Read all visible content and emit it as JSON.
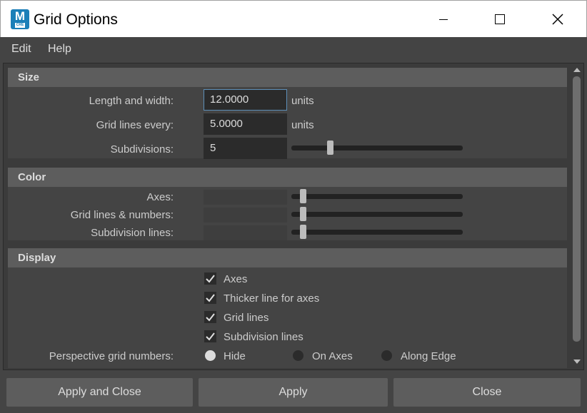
{
  "window": {
    "title": "Grid Options",
    "app_icon_letter": "M",
    "app_icon_badge": "CRE",
    "controls": {
      "minimize": "minimize-icon",
      "maximize": "maximize-icon",
      "close": "close-icon"
    }
  },
  "menu": [
    {
      "label": "Edit"
    },
    {
      "label": "Help"
    }
  ],
  "sections": {
    "size": {
      "title": "Size",
      "length_width": {
        "label": "Length and width:",
        "value": "12.0000",
        "unit": "units"
      },
      "grid_lines_every": {
        "label": "Grid lines every:",
        "value": "5.0000",
        "unit": "units"
      },
      "subdivisions": {
        "label": "Subdivisions:",
        "value": "5"
      }
    },
    "color": {
      "title": "Color",
      "axes": {
        "label": "Axes:"
      },
      "grid_lines_numbers": {
        "label": "Grid lines & numbers:"
      },
      "subdivision_lines": {
        "label": "Subdivision lines:"
      }
    },
    "display": {
      "title": "Display",
      "checkboxes": [
        {
          "label": "Axes",
          "checked": true
        },
        {
          "label": "Thicker line for axes",
          "checked": true
        },
        {
          "label": "Grid lines",
          "checked": true
        },
        {
          "label": "Subdivision lines",
          "checked": true
        }
      ],
      "perspective": {
        "label": "Perspective grid numbers:",
        "options": [
          {
            "label": "Hide",
            "selected": true
          },
          {
            "label": "On Axes",
            "selected": false
          },
          {
            "label": "Along Edge",
            "selected": false
          }
        ]
      }
    }
  },
  "footer": {
    "apply_close": "Apply and Close",
    "apply": "Apply",
    "close": "Close"
  },
  "colors": {
    "background": "#444444",
    "section_header": "#5d5d5d",
    "field": "#2b2b2b",
    "focus_border": "#5d8fb8",
    "app_icon": "#1b7fb8"
  }
}
